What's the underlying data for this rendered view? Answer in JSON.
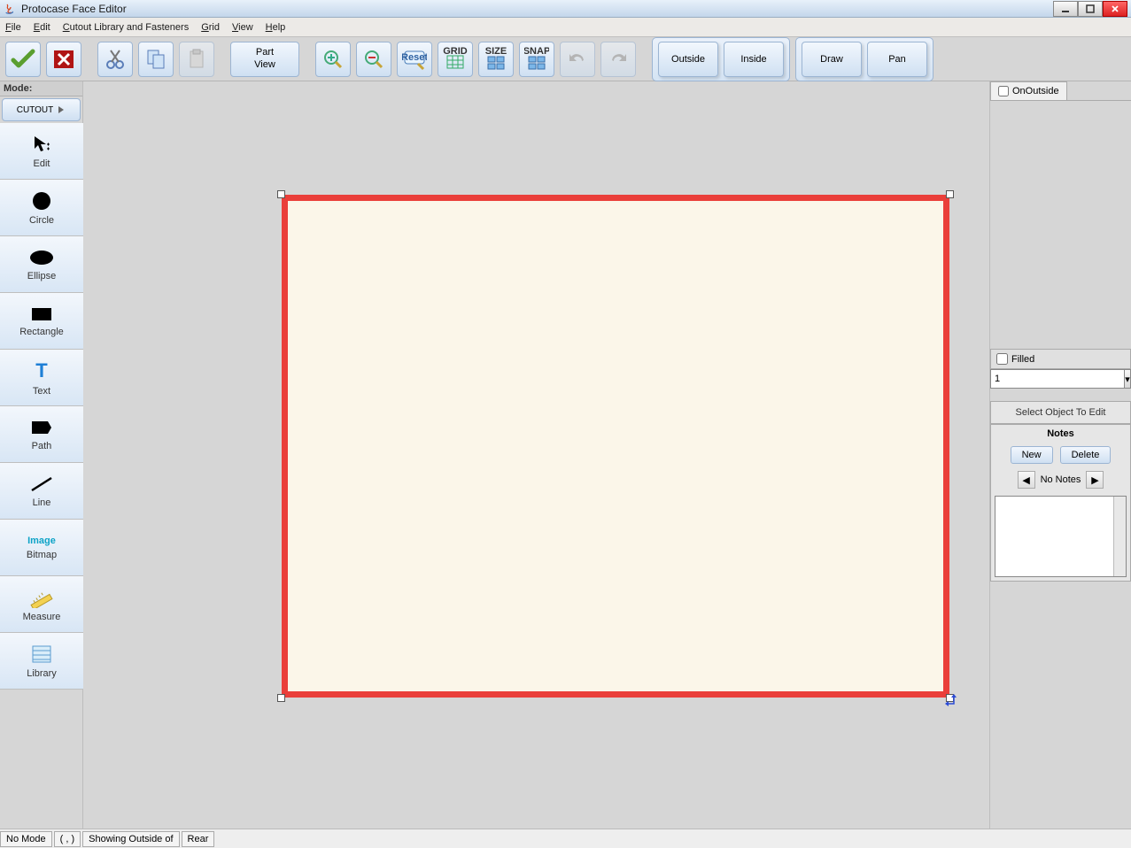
{
  "window": {
    "title": "Protocase Face Editor"
  },
  "menu": {
    "file": "File",
    "edit": "Edit",
    "cutout": "Cutout Library and Fasteners",
    "grid": "Grid",
    "view": "View",
    "help": "Help"
  },
  "toolbar": {
    "part_view_l1": "Part",
    "part_view_l2": "View",
    "outside": "Outside",
    "inside": "Inside",
    "draw": "Draw",
    "pan": "Pan",
    "grid_label": "GRID",
    "size_label": "SIZE",
    "snap_label": "SNAP",
    "reset_label": "Reset"
  },
  "left": {
    "mode_label": "Mode:",
    "mode_value": "CUTOUT",
    "tools": {
      "edit": "Edit",
      "circle": "Circle",
      "ellipse": "Ellipse",
      "rectangle": "Rectangle",
      "text": "Text",
      "text_glyph": "T",
      "path": "Path",
      "line": "Line",
      "image_glyph": "Image",
      "bitmap": "Bitmap",
      "measure": "Measure",
      "library": "Library"
    }
  },
  "right": {
    "onoutside": "OnOutside",
    "filled": "Filled",
    "dropdown_value": "1",
    "select_object": "Select Object To Edit",
    "notes_title": "Notes",
    "new_btn": "New",
    "delete_btn": "Delete",
    "no_notes": "No Notes"
  },
  "status": {
    "mode": "No Mode",
    "coords": "( , )",
    "showing": "Showing Outside of",
    "face": "Rear"
  }
}
